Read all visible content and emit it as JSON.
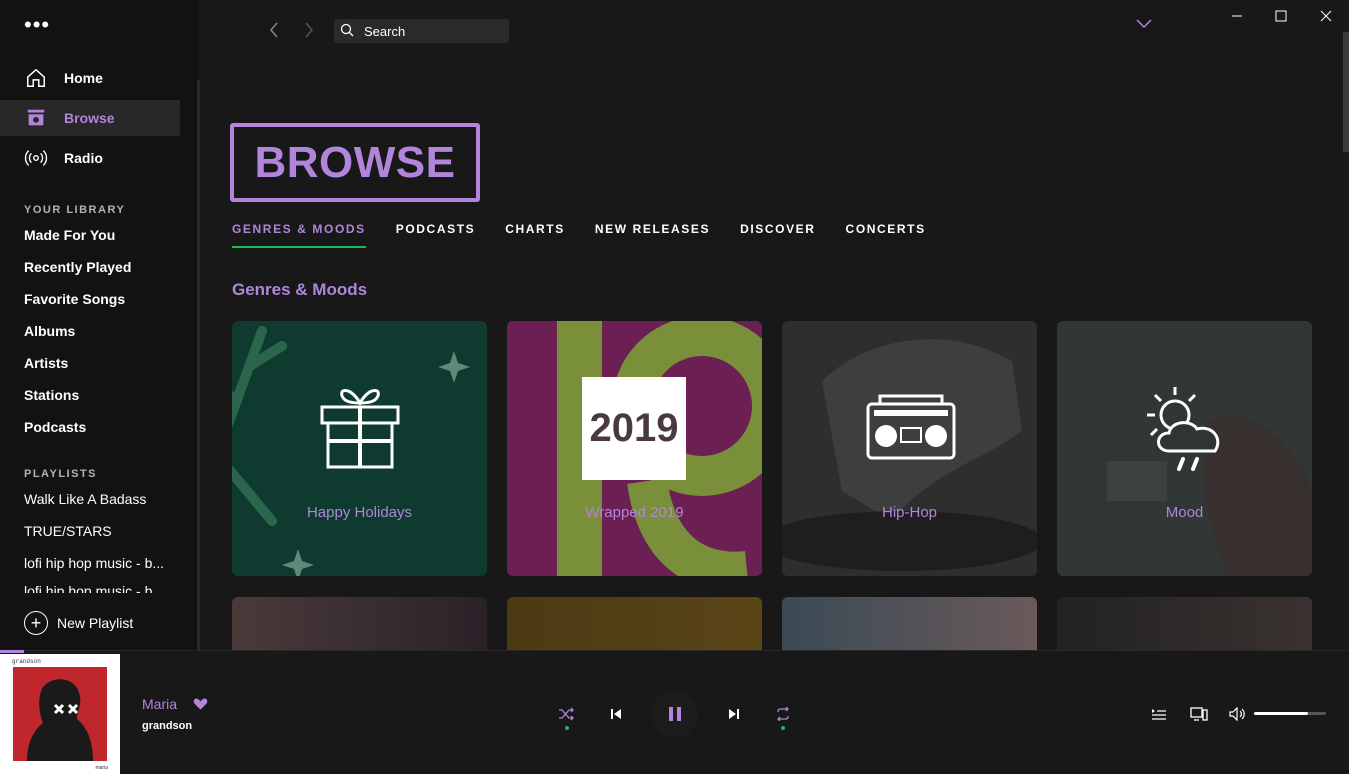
{
  "window": {
    "minimize": "—",
    "maximize": "☐",
    "close": "✕"
  },
  "topbar": {
    "search_placeholder": "Search"
  },
  "sidebar": {
    "nav": [
      {
        "label": "Home",
        "icon": "home-icon"
      },
      {
        "label": "Browse",
        "icon": "browse-icon",
        "active": true
      },
      {
        "label": "Radio",
        "icon": "radio-icon"
      }
    ],
    "library_title": "YOUR LIBRARY",
    "library": [
      "Made For You",
      "Recently Played",
      "Favorite Songs",
      "Albums",
      "Artists",
      "Stations",
      "Podcasts"
    ],
    "playlists_title": "PLAYLISTS",
    "playlists": [
      "Walk Like A Badass",
      "TRUE/STARS",
      "lofi hip hop music - b...",
      "lofi hip hop music - b..."
    ],
    "new_playlist": "New Playlist"
  },
  "main": {
    "heading": "BROWSE",
    "tabs": [
      "GENRES & MOODS",
      "PODCASTS",
      "CHARTS",
      "NEW RELEASES",
      "DISCOVER",
      "CONCERTS"
    ],
    "section_title": "Genres & Moods",
    "cards": [
      {
        "label": "Happy Holidays",
        "icon": "gift-icon",
        "bg": "#0f3a2f"
      },
      {
        "label": "Wrapped 2019",
        "badge": "2019",
        "bg": "#6b1f52"
      },
      {
        "label": "Hip-Hop",
        "icon": "boombox-icon",
        "bg": "#2a2a2a"
      },
      {
        "label": "Mood",
        "icon": "weather-icon",
        "bg": "#2f3434"
      }
    ]
  },
  "player": {
    "album_top_text": "grandson",
    "album_bottom_text": "maria",
    "track": "Maria",
    "artist": "grandson",
    "volume_level": 0.75,
    "accent": "#b185db",
    "green": "#1db954"
  }
}
